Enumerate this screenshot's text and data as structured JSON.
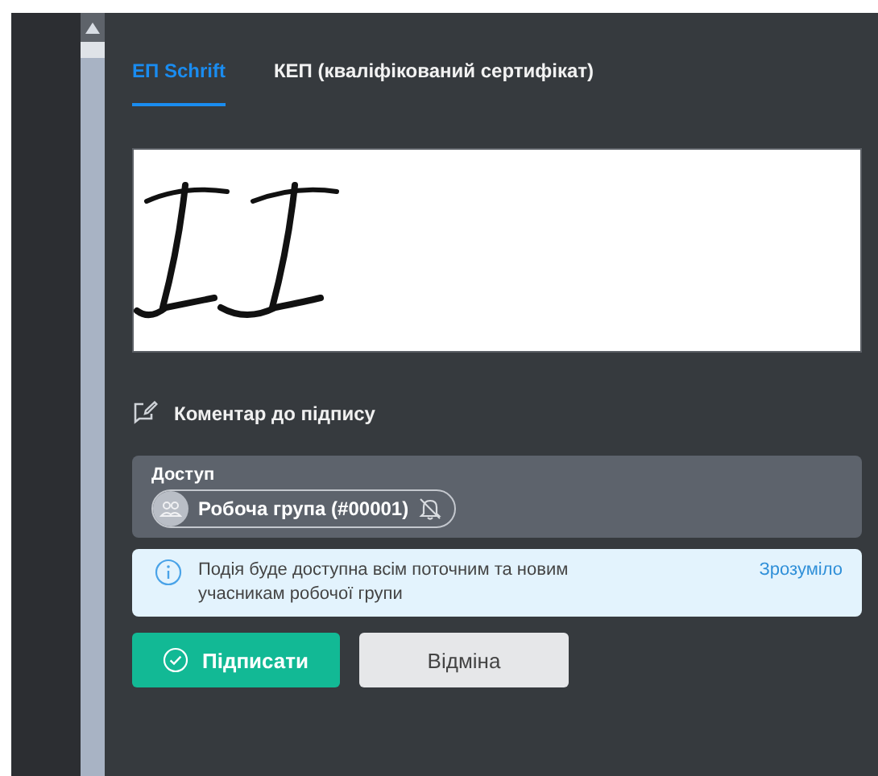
{
  "tabs": [
    {
      "label": "ЕП Schrift",
      "selected": true
    },
    {
      "label": "КЕП (кваліфікований сертифікат)",
      "selected": false
    }
  ],
  "comment_link": "Коментар до підпису",
  "access": {
    "label": "Доступ",
    "chip": "Робоча група (#00001)",
    "notifications_muted": true
  },
  "notice": {
    "text": "Подія буде доступна всім поточним та новим учасникам робочої групи",
    "action": "Зрозуміло"
  },
  "buttons": [
    {
      "label": "Підписати",
      "kind": "primary"
    },
    {
      "label": "Відміна",
      "kind": "secondary"
    }
  ]
}
